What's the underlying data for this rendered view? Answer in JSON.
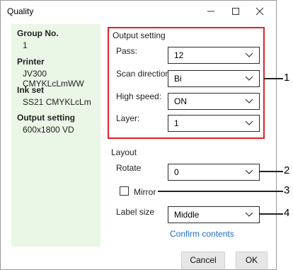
{
  "window": {
    "title": "Quality"
  },
  "info_panel": {
    "group_label": "Group No.",
    "group_value": "1",
    "printer_label": "Printer",
    "printer_value": "JV300 CMYKLcLmWW",
    "inkset_label": "Ink set",
    "inkset_value": "SS21 CMYKLcLm",
    "output_label": "Output setting",
    "output_value": "600x1800 VD"
  },
  "output_setting": {
    "title": "Output setting",
    "pass_label": "Pass:",
    "pass_value": "12",
    "scan_label": "Scan direction:",
    "scan_value": "Bi",
    "speed_label": "High speed:",
    "speed_value": "ON",
    "layer_label": "Layer:",
    "layer_value": "1"
  },
  "layout": {
    "title": "Layout",
    "rotate_label": "Rotate",
    "rotate_value": "0",
    "mirror_label": "Mirror",
    "mirror_checked": false,
    "label_size_label": "Label size",
    "label_size_value": "Middle",
    "confirm_link": "Confirm contents"
  },
  "buttons": {
    "cancel": "Cancel",
    "ok": "OK"
  },
  "callouts": [
    "1",
    "2",
    "3",
    "4"
  ],
  "colors": {
    "highlight_border": "#e0202a",
    "info_bg": "#eaf6e6",
    "link": "#1a6ec8"
  }
}
